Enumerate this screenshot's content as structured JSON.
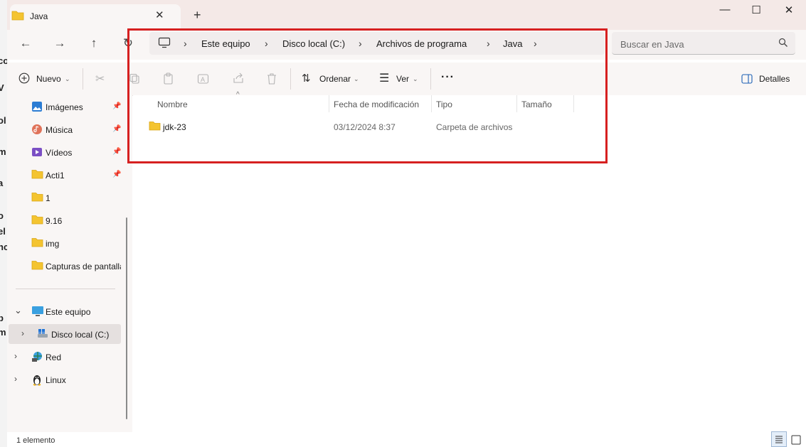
{
  "window": {
    "tab_title": "Java",
    "tab_close": "✕",
    "new_tab": "+",
    "minimize": "—",
    "maximize": "☐",
    "close": "✕"
  },
  "nav": {
    "back": "←",
    "forward": "→",
    "up": "↑",
    "refresh": "↻"
  },
  "address": {
    "crumbs": [
      "Este equipo",
      "Disco local (C:)",
      "Archivos de programa",
      "Java"
    ],
    "separator": "›"
  },
  "search": {
    "placeholder": "Buscar en Java"
  },
  "commands": {
    "new_label": "Nuevo",
    "sort_label": "Ordenar",
    "view_label": "Ver",
    "more": "···",
    "details_label": "Detalles"
  },
  "sidebar": {
    "quick_access": [
      {
        "label": "Imágenes",
        "icon": "pictures-icon",
        "pinned": true
      },
      {
        "label": "Música",
        "icon": "music-icon",
        "pinned": true
      },
      {
        "label": "Vídeos",
        "icon": "videos-icon",
        "pinned": true
      },
      {
        "label": "Acti1",
        "icon": "folder-icon",
        "pinned": true
      },
      {
        "label": "1",
        "icon": "folder-icon",
        "pinned": false
      },
      {
        "label": "9.16",
        "icon": "folder-icon",
        "pinned": false
      },
      {
        "label": "img",
        "icon": "folder-icon",
        "pinned": false
      },
      {
        "label": "Capturas de pantalla",
        "icon": "folder-icon",
        "pinned": false
      }
    ],
    "tree": [
      {
        "label": "Este equipo",
        "icon": "pc-icon",
        "expanded": true
      },
      {
        "label": "Disco local (C:)",
        "icon": "drive-icon",
        "selected": true
      },
      {
        "label": "Red",
        "icon": "network-icon"
      },
      {
        "label": "Linux",
        "icon": "linux-icon"
      }
    ]
  },
  "columns": {
    "name": "Nombre",
    "modified": "Fecha de modificación",
    "type": "Tipo",
    "size": "Tamaño"
  },
  "files": [
    {
      "name": "jdk-23",
      "modified": "03/12/2024 8:37",
      "type": "Carpeta de archivos",
      "size": ""
    }
  ],
  "status": {
    "item_count": "1 elemento"
  },
  "colors": {
    "highlight": "#d62020",
    "folder": "#f4c430",
    "titlebar": "#f4e9e7"
  }
}
